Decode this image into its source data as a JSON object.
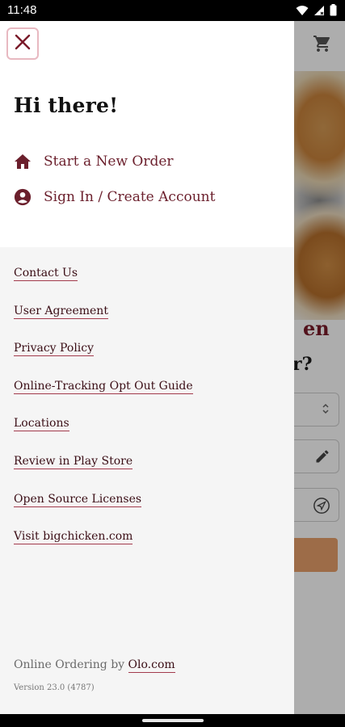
{
  "status_bar": {
    "time": "11:48",
    "icons": [
      "wifi-icon",
      "signal-icon",
      "battery-icon"
    ]
  },
  "drawer": {
    "greeting": "Hi there!",
    "menu": [
      {
        "label": "Start a New Order",
        "icon": "home-icon"
      },
      {
        "label": "Sign In / Create Account",
        "icon": "account-circle-icon"
      }
    ],
    "links": [
      "Contact Us",
      "User Agreement",
      "Privacy Policy",
      "Online-Tracking Opt Out Guide",
      "Locations",
      "Review in Play Store",
      "Open Source Licenses",
      "Visit bigchicken.com"
    ],
    "footer": {
      "prefix": "Online Ordering by ",
      "link": "Olo.com",
      "version": "Version 23.0 (4787)"
    }
  },
  "background": {
    "heading_partial": "en",
    "subheading_partial": "r?"
  },
  "colors": {
    "brand": "#6b1f2c",
    "accent": "#e8a06a",
    "drawer_bg": "#f5f5f5"
  }
}
